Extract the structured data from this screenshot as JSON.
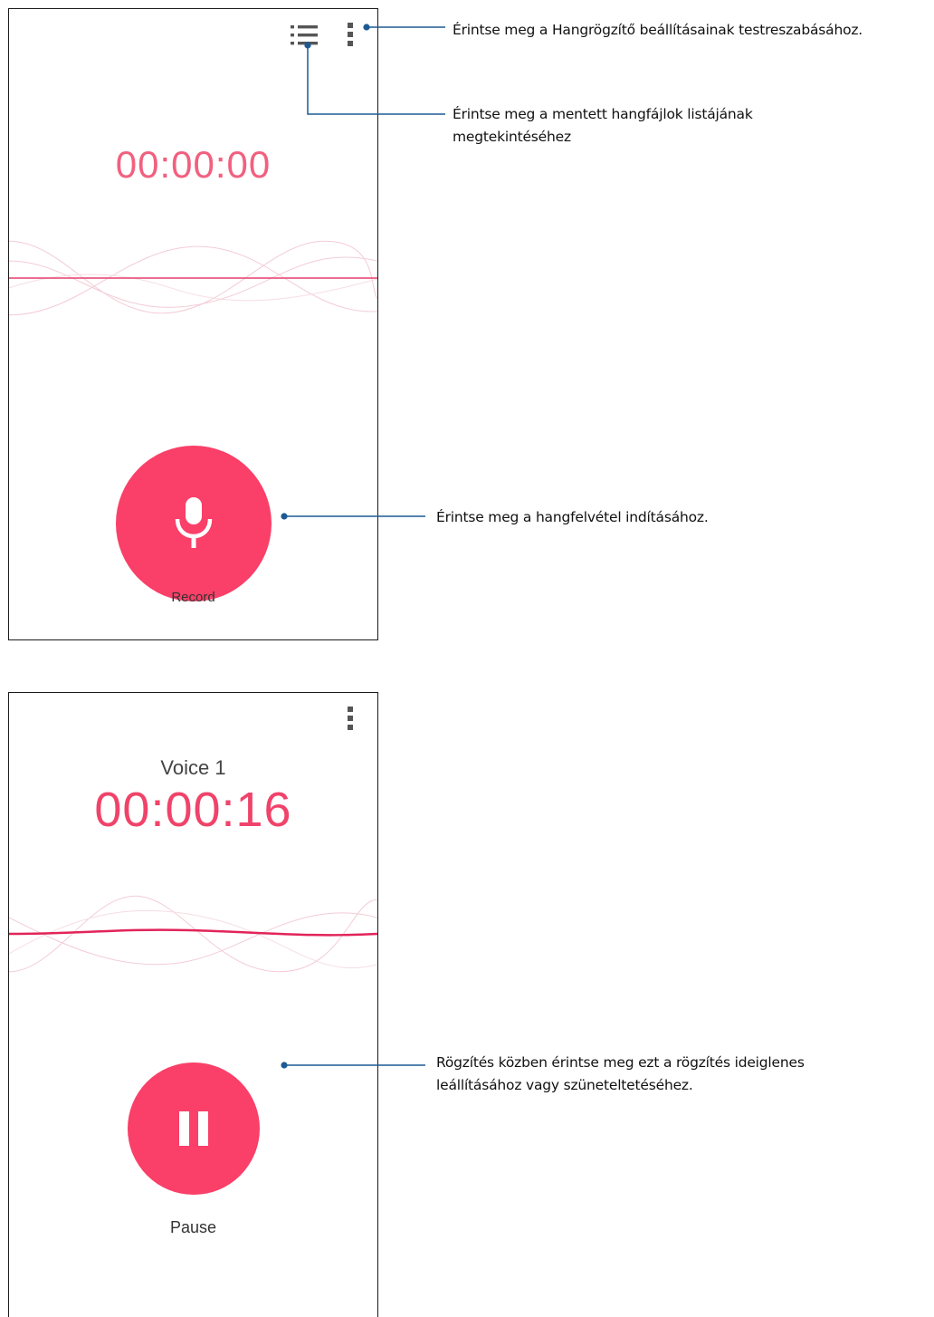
{
  "screen1": {
    "timer": "00:00:00",
    "record_label": "Record",
    "icons": [
      "list-icon",
      "more-vert-icon",
      "microphone-icon"
    ]
  },
  "screen2": {
    "recording_name": "Voice 1",
    "timer": "00:00:16",
    "pause_label": "Pause",
    "icons": [
      "more-vert-icon",
      "pause-icon"
    ]
  },
  "callouts": {
    "settings": "Érintse meg a Hangrögzítő beállításainak testreszabásához.",
    "list_line1": "Érintse meg a mentett hangfájlok listájának",
    "list_line2": "megtekintéséhez",
    "record": "Érintse meg a hangfelvétel indításához.",
    "pause_line1": "Rögzítés közben érintse meg ezt a rögzítés ideiglenes",
    "pause_line2": "leállításához vagy szüneteltetéséhez."
  },
  "colors": {
    "accent": "#fa3f68",
    "timer_idle": "#f2607f",
    "leader_line": "#1d5a94",
    "frame": "#1a1a1a"
  }
}
